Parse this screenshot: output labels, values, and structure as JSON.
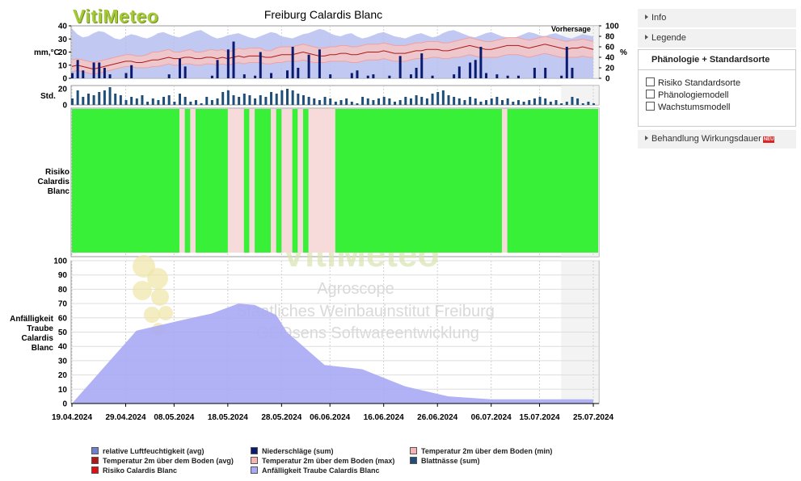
{
  "header": {
    "logo_text": "VitiMeteo",
    "chart_title": "Freiburg Calardis Blanc",
    "forecast_label": "Vorhersage"
  },
  "panel": {
    "items": [
      {
        "label": "Info"
      },
      {
        "label": "Legende"
      }
    ],
    "active_section": "Phänologie + Standardsorte",
    "options": [
      {
        "label": "Risiko Standardsorte",
        "checked": false
      },
      {
        "label": "Phänologiemodell",
        "checked": false
      },
      {
        "label": "Wachstumsmodell",
        "checked": false
      }
    ],
    "last_item": {
      "label": "Behandlung Wirkungsdauer",
      "badge": "NEU"
    }
  },
  "watermark": {
    "logo": "VitiMeteo",
    "line1": "Agroscope",
    "line2": "Staatliches Weinbauinstitut Freiburg",
    "line3": "GEOsens Softwareentwicklung"
  },
  "legend": [
    {
      "label": "relative Luftfeuchtigkeit (avg)",
      "color": "#6f7fd0"
    },
    {
      "label": "Niederschläge (sum)",
      "color": "#0a1a6e"
    },
    {
      "label": "Temperatur 2m über dem Boden (min)",
      "color": "#f4b4b4"
    },
    {
      "label": "Temperatur 2m über dem Boden (avg)",
      "color": "#b01818"
    },
    {
      "label": "Temperatur 2m über dem Boden (max)",
      "color": "#f4b4b4"
    },
    {
      "label": "Blattnässe (sum)",
      "color": "#1f4e79"
    },
    {
      "label": "Risiko Calardis Blanc",
      "color": "#e01010"
    },
    {
      "label": "Anfälligkeit Traube Calardis Blanc",
      "color": "#a9a8f4"
    }
  ],
  "chart_data": {
    "type": "area",
    "title": "Freiburg Calardis Blanc",
    "x_tick_labels": [
      "19.04.2024",
      "29.04.2024",
      "08.05.2024",
      "18.05.2024",
      "28.05.2024",
      "06.06.2024",
      "16.06.2024",
      "26.06.2024",
      "06.07.2024",
      "15.07.2024",
      "25.07.2024"
    ],
    "x_days": [
      0,
      10,
      19,
      29,
      39,
      48,
      58,
      68,
      78,
      87,
      97
    ],
    "forecast_start_day": 91,
    "weather_panel": {
      "left_axis_label": "mm,°C",
      "left_ticks": [
        "40",
        "30",
        "20",
        "10",
        "0"
      ],
      "left_ylim": [
        0,
        40
      ],
      "right_axis_label": "%",
      "right_ticks": [
        "100",
        "80",
        "60",
        "40",
        "20",
        "0"
      ],
      "right_ylim": [
        0,
        100
      ],
      "precip_days": [
        0,
        1,
        2,
        4,
        5,
        6,
        7,
        10,
        11,
        18,
        20,
        21,
        26,
        27,
        29,
        30,
        32,
        34,
        35,
        37,
        40,
        41,
        42,
        44,
        46,
        48,
        52,
        53,
        55,
        56,
        59,
        61,
        63,
        64,
        65,
        67,
        71,
        72,
        74,
        75,
        76,
        77,
        79,
        81,
        83,
        86,
        88,
        91,
        92,
        93
      ],
      "precip_mm": [
        4,
        14,
        6,
        12,
        12,
        8,
        3,
        4,
        10,
        3,
        15,
        9,
        2,
        14,
        22,
        28,
        3,
        2,
        20,
        4,
        6,
        24,
        8,
        18,
        22,
        3,
        4,
        6,
        2,
        3,
        2,
        17,
        3,
        8,
        19,
        2,
        3,
        9,
        12,
        14,
        24,
        4,
        3,
        2,
        2,
        8,
        8,
        2,
        24,
        8,
        3
      ],
      "humidity_pct": [
        95,
        84,
        78,
        80,
        86,
        90,
        88,
        82,
        76,
        74,
        80,
        84,
        82,
        78,
        76,
        80,
        86,
        88,
        84,
        80,
        78,
        82,
        86,
        90,
        92,
        86,
        80,
        76,
        78,
        82,
        84,
        86,
        82,
        78,
        76,
        80,
        84,
        88,
        86,
        80,
        78,
        76,
        80,
        84,
        86,
        90,
        94,
        92,
        86,
        82,
        80,
        84,
        86,
        80,
        76,
        78,
        82,
        86,
        88,
        84,
        80,
        78,
        76,
        80,
        84,
        86,
        82,
        78,
        80,
        86,
        90,
        92,
        88,
        84,
        80,
        78,
        82,
        86,
        88,
        84,
        80,
        78,
        76,
        80,
        84,
        88,
        86,
        82,
        80,
        84,
        86,
        82,
        78,
        76,
        80,
        84,
        82,
        80
      ],
      "temp_avg": [
        9,
        10,
        9,
        8,
        7,
        8,
        9,
        10,
        11,
        12,
        13,
        13,
        12,
        12,
        13,
        14,
        14,
        15,
        16,
        15,
        15,
        16,
        16,
        15,
        15,
        16,
        16,
        15,
        16,
        15,
        16,
        17,
        16,
        17,
        17,
        17,
        16,
        16,
        17,
        18,
        18,
        18,
        19,
        20,
        19,
        18,
        17,
        17,
        18,
        18,
        19,
        19,
        18,
        18,
        19,
        20,
        20,
        20,
        21,
        20,
        19,
        19,
        19,
        20,
        21,
        21,
        22,
        22,
        22,
        21,
        21,
        22,
        23,
        24,
        25,
        24,
        23,
        22,
        22,
        23,
        24,
        25,
        25,
        25,
        24,
        23,
        24,
        25,
        26,
        25,
        24,
        23,
        22,
        23,
        23,
        24,
        23,
        22
      ],
      "temp_min": [
        5,
        6,
        5,
        4,
        3,
        4,
        5,
        6,
        7,
        8,
        9,
        9,
        8,
        8,
        8,
        9,
        9,
        10,
        11,
        10,
        10,
        11,
        11,
        10,
        10,
        11,
        11,
        10,
        11,
        10,
        11,
        12,
        11,
        12,
        12,
        12,
        11,
        11,
        12,
        12,
        13,
        13,
        13,
        14,
        13,
        12,
        12,
        12,
        13,
        13,
        13,
        13,
        12,
        12,
        13,
        14,
        14,
        14,
        15,
        14,
        13,
        13,
        13,
        14,
        15,
        15,
        15,
        16,
        16,
        15,
        15,
        16,
        16,
        17,
        18,
        17,
        16,
        16,
        16,
        16,
        17,
        18,
        18,
        18,
        17,
        16,
        17,
        18,
        19,
        18,
        17,
        16,
        16,
        16,
        16,
        17,
        16,
        16
      ],
      "temp_max": [
        14,
        15,
        14,
        13,
        12,
        13,
        14,
        15,
        16,
        17,
        18,
        18,
        17,
        17,
        18,
        20,
        20,
        21,
        22,
        20,
        20,
        21,
        22,
        20,
        20,
        21,
        22,
        21,
        22,
        20,
        21,
        23,
        22,
        23,
        23,
        23,
        21,
        21,
        23,
        24,
        24,
        24,
        25,
        26,
        25,
        24,
        23,
        23,
        24,
        24,
        25,
        25,
        24,
        24,
        25,
        26,
        26,
        26,
        27,
        26,
        25,
        25,
        25,
        26,
        27,
        27,
        28,
        28,
        28,
        27,
        27,
        28,
        29,
        30,
        31,
        30,
        29,
        28,
        28,
        29,
        30,
        31,
        31,
        31,
        30,
        29,
        30,
        31,
        32,
        31,
        30,
        29,
        28,
        29,
        29,
        30,
        29,
        28
      ]
    },
    "leaf_wetness_panel": {
      "axis_label": "Std.",
      "ticks": [
        "20",
        "0"
      ],
      "ylim": [
        0,
        24
      ],
      "hours": [
        8,
        18,
        10,
        14,
        12,
        16,
        18,
        22,
        14,
        12,
        6,
        10,
        8,
        12,
        4,
        8,
        6,
        10,
        12,
        4,
        14,
        10,
        4,
        6,
        2,
        10,
        6,
        8,
        16,
        18,
        12,
        10,
        14,
        12,
        8,
        12,
        10,
        16,
        14,
        18,
        20,
        18,
        14,
        12,
        10,
        8,
        6,
        10,
        8,
        4,
        6,
        8,
        4,
        2,
        10,
        8,
        6,
        8,
        10,
        8,
        4,
        6,
        10,
        8,
        12,
        10,
        8,
        14,
        16,
        18,
        12,
        10,
        8,
        6,
        10,
        8,
        4,
        6,
        8,
        10,
        6,
        8,
        4,
        6,
        4,
        6,
        8,
        10,
        8,
        4,
        6,
        2,
        4,
        10,
        8,
        2,
        4,
        2
      ]
    },
    "risk_panel": {
      "axis_label": "Risiko Calardis Blanc",
      "green": "#38f038",
      "pink": "#f7dada",
      "pink_bands_days": [
        [
          20,
          21
        ],
        [
          22,
          23
        ],
        [
          29,
          32
        ],
        [
          33,
          34
        ],
        [
          37,
          38
        ],
        [
          39,
          41
        ],
        [
          42,
          43
        ],
        [
          44,
          49
        ],
        [
          80,
          81
        ]
      ],
      "end_day": 97
    },
    "susceptibility_panel": {
      "axis_label": "Anfälligkeit Traube Calardis Blanc",
      "yticks": [
        "100",
        "90",
        "80",
        "70",
        "60",
        "50",
        "40",
        "30",
        "20",
        "10",
        "0"
      ],
      "ylim": [
        0,
        100
      ],
      "days": [
        0,
        12,
        20,
        26,
        31,
        34,
        38,
        40,
        47,
        54,
        62,
        70,
        78,
        97
      ],
      "values": [
        0,
        51,
        58,
        63,
        70,
        69,
        62,
        50,
        27,
        24,
        12,
        5,
        3,
        3
      ]
    }
  }
}
